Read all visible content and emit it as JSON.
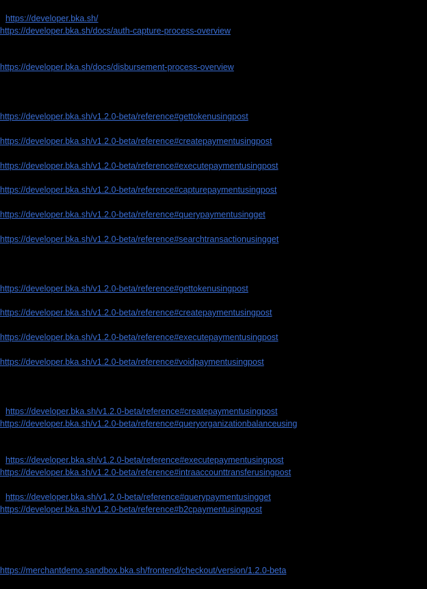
{
  "links": [
    "https://developer.bka.sh/",
    "https://developer.bka.sh/docs/auth-capture-process-overview",
    "https://developer.bka.sh/docs/disbursement-process-overview",
    "https://developer.bka.sh/v1.2.0-beta/reference#gettokenusingpost",
    "https://developer.bka.sh/v1.2.0-beta/reference#createpaymentusingpost",
    "https://developer.bka.sh/v1.2.0-beta/reference#executepaymentusingpost",
    "https://developer.bka.sh/v1.2.0-beta/reference#capturepaymentusingpost",
    "https://developer.bka.sh/v1.2.0-beta/reference#querypaymentusingget",
    "https://developer.bka.sh/v1.2.0-beta/reference#searchtransactionusingget",
    "https://developer.bka.sh/v1.2.0-beta/reference#gettokenusingpost",
    "https://developer.bka.sh/v1.2.0-beta/reference#createpaymentusingpost",
    "https://developer.bka.sh/v1.2.0-beta/reference#executepaymentusingpost",
    "https://developer.bka.sh/v1.2.0-beta/reference#voidpaymentusingpost",
    "https://developer.bka.sh/v1.2.0-beta/reference#createpaymentusingpost",
    "https://developer.bka.sh/v1.2.0-beta/reference#queryorganizationbalanceusing",
    "https://developer.bka.sh/v1.2.0-beta/reference#executepaymentusingpost",
    "https://developer.bka.sh/v1.2.0-beta/reference#intraaccounttransferusingpost",
    "https://developer.bka.sh/v1.2.0-beta/reference#querypaymentusingget",
    "https://developer.bka.sh/v1.2.0-beta/reference#b2cpaymentusingpost",
    "https://merchantdemo.sandbox.bka.sh/frontend/checkout/version/1.2.0-beta"
  ],
  "colors": {
    "background": "#000000",
    "link": "#3b6fd6"
  }
}
